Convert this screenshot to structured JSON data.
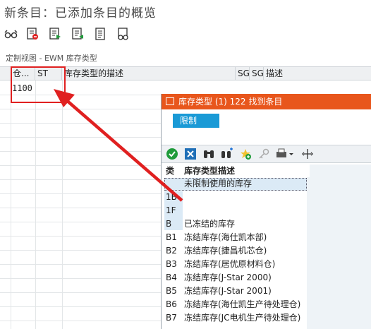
{
  "header": {
    "title": "新条目：已添加条目的概览"
  },
  "toolbar": {
    "icons": [
      "glasses-icon",
      "delete-entry-icon",
      "flag-green-icon",
      "flag-green-icon",
      "document-icon",
      "binoculars-glasses-icon"
    ]
  },
  "view": {
    "subtitle": "定制视图 - EWM 库存类型"
  },
  "table": {
    "columns": [
      "仓...",
      "ST",
      "库存类型的描述",
      "SG",
      "SG",
      "描述"
    ],
    "cell_value": "1100"
  },
  "popup": {
    "title": "库存类型 (1)  122 找到条目",
    "restrict_tab": "限制",
    "list_headers": {
      "code": "类",
      "description": "库存类型描述"
    },
    "rows": [
      {
        "code": "",
        "description": "未限制使用的库存"
      },
      {
        "code": "1B",
        "description": ""
      },
      {
        "code": "1F",
        "description": ""
      },
      {
        "code": "B",
        "description": "已冻结的库存"
      },
      {
        "code": "B1",
        "description": "冻结库存(海仕凯本部)"
      },
      {
        "code": "B2",
        "description": "冻结库存(捷昌机芯仓)"
      },
      {
        "code": "B3",
        "description": "冻结库存(居优原材料仓)"
      },
      {
        "code": "B4",
        "description": "冻结库存(J-Star 2000)"
      },
      {
        "code": "B5",
        "description": "冻结库存(J-Star 2001)"
      },
      {
        "code": "B6",
        "description": "冻结库存(海仕凯生产待处理仓)"
      },
      {
        "code": "B7",
        "description": "冻结库存(JC电机生产待处理仓)"
      }
    ]
  },
  "colors": {
    "popup_title_bg": "#e8561c",
    "restrict_tab_bg": "#1a9ad6",
    "annotation": "#e02020"
  }
}
